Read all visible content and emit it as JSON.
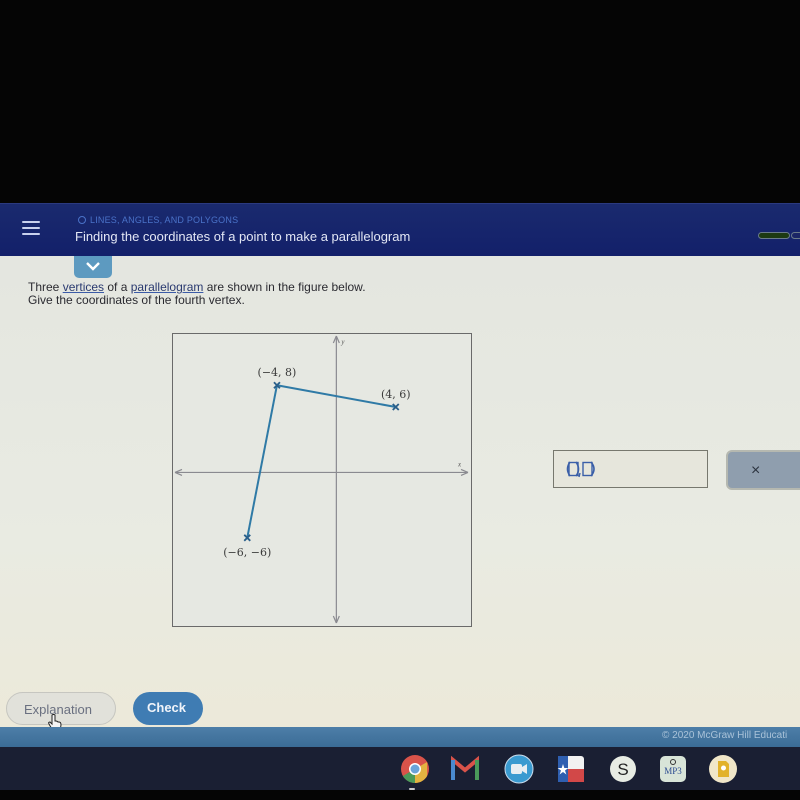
{
  "header": {
    "topic": "LINES, ANGLES, AND POLYGONS",
    "title": "Finding the coordinates of a point to make a parallelogram",
    "menu_icon": "hamburger-menu-icon",
    "progress_icon": "progress-bar"
  },
  "question": {
    "part1": "Three ",
    "link1": "vertices",
    "part2": " of a ",
    "link2": "parallelogram",
    "part3": " are shown in the figure below.",
    "line2": "Give the coordinates of the fourth vertex."
  },
  "graph": {
    "x_axis_label": "x",
    "y_axis_label": "y",
    "x_range": [
      -11,
      9
    ],
    "y_range": [
      -14,
      12.7
    ],
    "line_color": "#2f7aa6",
    "points": [
      {
        "x": -6,
        "y": -6,
        "label": "(−6, −6)",
        "label_pos": "below"
      },
      {
        "x": -4,
        "y": 8,
        "label": "(−4, 8)",
        "label_pos": "above"
      },
      {
        "x": 4,
        "y": 6,
        "label": "(4, 6)",
        "label_pos": "above"
      }
    ],
    "segments": [
      [
        0,
        1
      ],
      [
        1,
        2
      ]
    ]
  },
  "answer": {
    "value": "",
    "icon": "ordered-pair-icon"
  },
  "buttons": {
    "clear": "×",
    "explanation": "Explanation",
    "check": "Check"
  },
  "footer": {
    "copyright": "© 2020 McGraw Hill Educati"
  },
  "shelf": {
    "apps": [
      "chrome",
      "gmail",
      "zoom",
      "texas-app",
      "schoology",
      "mp3-app",
      "keep"
    ]
  },
  "colors": {
    "header_bg": "#13206a",
    "accent": "#3f7cb3",
    "footer_bg": "#3b6c96"
  }
}
